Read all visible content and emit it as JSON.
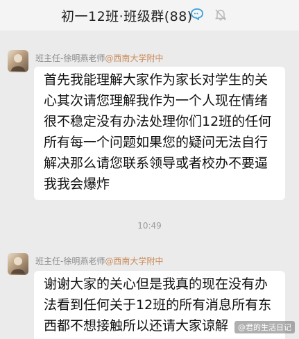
{
  "header": {
    "title": "初一12班·班级群(88)",
    "chat_icon": "speech-bubble-icon",
    "mute_icon": "bell-muted-icon"
  },
  "messages": [
    {
      "sender_name": "班主任-徐明燕老师",
      "sender_school": "@西南大学附中",
      "text": "首先我能理解大家作为家长对学生的关心其次请您理解我作为一个人现在情绪很不稳定没有办法处理你们12班的任何所有每一个问题如果您的疑问无法自行解决那么请您联系领导或者校办不要逼我我会爆炸"
    },
    {
      "sender_name": "班主任-徐明燕老师",
      "sender_school": "@西南大学附中",
      "text": "谢谢大家的关心但是我真的现在没有办法看到任何关于12班的所有消息所有东西都不想接触所以还请大家谅解"
    }
  ],
  "timestamp": "10:49",
  "watermark": "@君的生活日记",
  "colors": {
    "background": "#ebebeb",
    "bubble": "#ffffff",
    "school_tag": "#c98c5c"
  }
}
